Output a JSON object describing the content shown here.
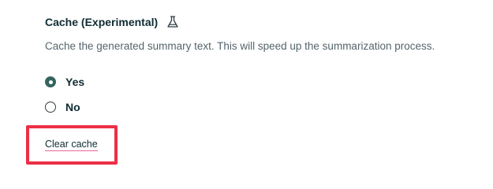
{
  "setting": {
    "title": "Cache (Experimental)",
    "title_icon": "flask-icon",
    "description": "Cache the generated summary text. This will speed up the summarization process."
  },
  "options": [
    {
      "label": "Yes",
      "selected": true
    },
    {
      "label": "No",
      "selected": false
    }
  ],
  "actions": {
    "clear_cache_label": "Clear cache"
  },
  "colors": {
    "title": "#0f2c33",
    "description": "#55656b",
    "radio_selected": "#35655f",
    "highlight_box": "#ec2f45",
    "link_underline": "#e8659b"
  }
}
